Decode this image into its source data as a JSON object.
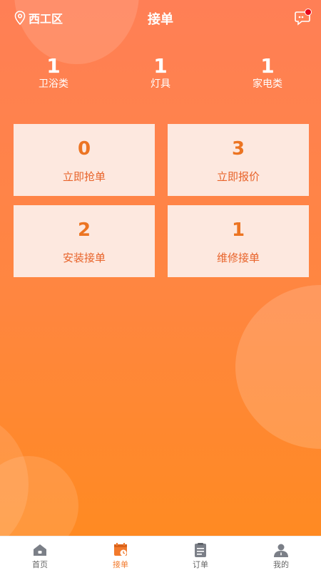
{
  "header": {
    "location": "西工区",
    "title": "接单",
    "location_icon": "location-pin-icon",
    "message_icon": "chat-bubble-icon"
  },
  "stats": [
    {
      "value": "1",
      "label": "卫浴类"
    },
    {
      "value": "1",
      "label": "灯具"
    },
    {
      "value": "1",
      "label": "家电类"
    }
  ],
  "cards": [
    {
      "value": "0",
      "label": "立即抢单"
    },
    {
      "value": "3",
      "label": "立即报价"
    },
    {
      "value": "2",
      "label": "安装接单"
    },
    {
      "value": "1",
      "label": "维修接单"
    }
  ],
  "tabs": [
    {
      "label": "首页",
      "icon": "home-icon"
    },
    {
      "label": "接单",
      "icon": "calendar-order-icon",
      "active": true
    },
    {
      "label": "订单",
      "icon": "clipboard-icon"
    },
    {
      "label": "我的",
      "icon": "user-icon"
    }
  ],
  "colors": {
    "accent": "#f27a2c",
    "card_bg": "#fde8df",
    "card_text": "#ec7422",
    "badge": "#e8071b"
  }
}
